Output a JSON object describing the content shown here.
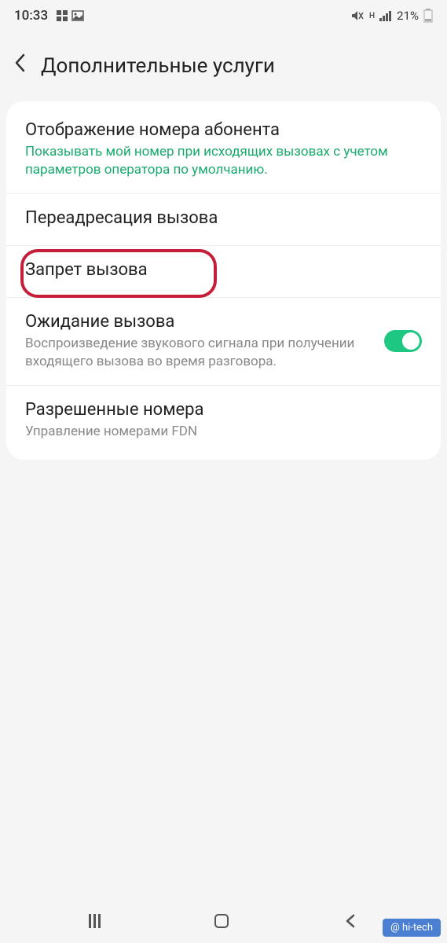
{
  "status": {
    "time": "10:33",
    "battery_percent": "21%"
  },
  "header": {
    "title": "Дополнительные услуги"
  },
  "settings": [
    {
      "title": "Отображение номера абонента",
      "subtitle": "Показывать мой номер при исходящих вызовах с учетом параметров оператора по умолчанию.",
      "subtitle_accent": true
    },
    {
      "title": "Переадресация вызова"
    },
    {
      "title": "Запрет вызова",
      "highlighted": true
    },
    {
      "title": "Ожидание вызова",
      "subtitle": "Воспроизведение звукового сигнала при получении входящего вызова во время разговора.",
      "toggle": true,
      "toggle_on": true
    },
    {
      "title": "Разрешенные номера",
      "subtitle": "Управление номерами FDN"
    }
  ],
  "watermark": "@ hi-tech"
}
